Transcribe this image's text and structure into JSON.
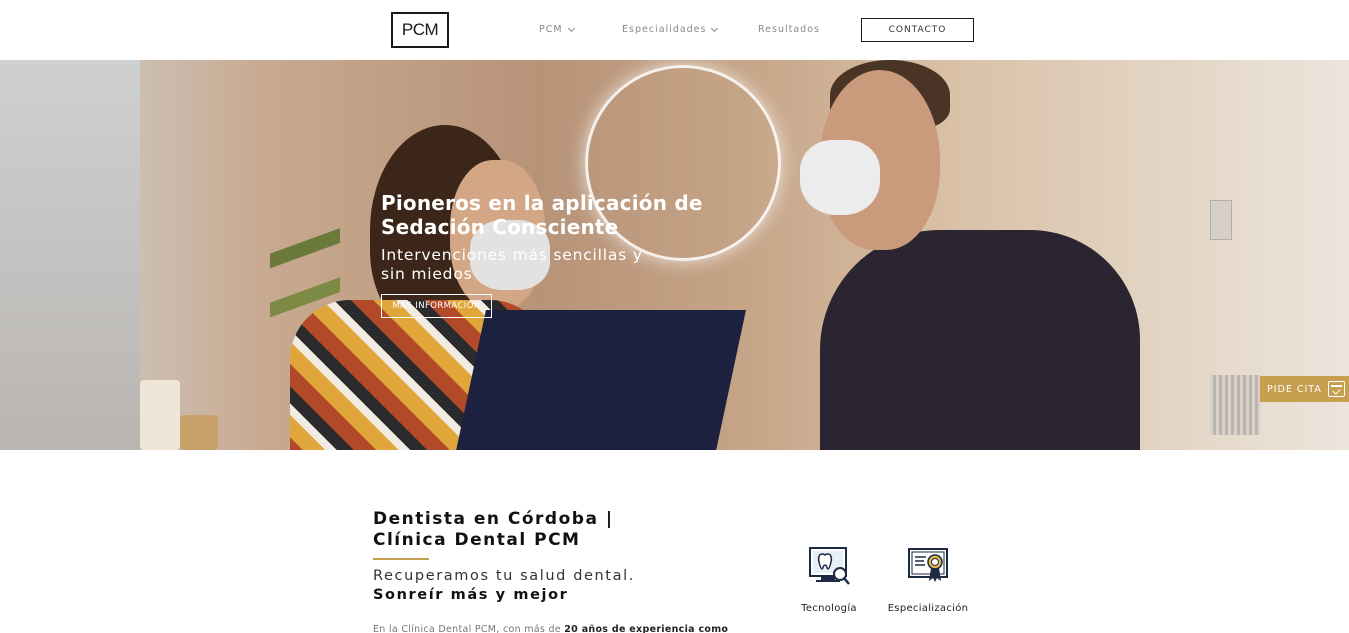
{
  "header": {
    "logo": "PCM",
    "nav": [
      {
        "label": "PCM",
        "has_dropdown": true
      },
      {
        "label": "Especialidades",
        "has_dropdown": true
      },
      {
        "label": "Resultados",
        "has_dropdown": false
      }
    ],
    "contact_label": "CONTACTO"
  },
  "hero": {
    "title_line1": "Pioneros en la aplicación de",
    "title_line2": "Sedación Consciente",
    "subtitle_line1": "Intervenciones más sencillas y",
    "subtitle_line2": "sin miedos",
    "button_label": "MAS INFORMACIÓN"
  },
  "floating": {
    "pide_cita_label": "PIDE CITA",
    "icon": "calendar-check-icon",
    "color": "#c6a04f"
  },
  "content": {
    "title_line1": "Dentista en Córdoba |",
    "title_line2": "Clínica Dental PCM",
    "tagline": "Recuperamos tu salud dental.",
    "tagline_strong": "Sonreír más y mejor",
    "intro_prefix": "En la Clínica Dental PCM, con más de ",
    "intro_bold": "20 años de experiencia como",
    "accent_color": "#c6a04f"
  },
  "features": [
    {
      "label": "Tecnología",
      "icon": "dental-technology-icon"
    },
    {
      "label": "Especialización",
      "icon": "certificate-icon"
    }
  ]
}
